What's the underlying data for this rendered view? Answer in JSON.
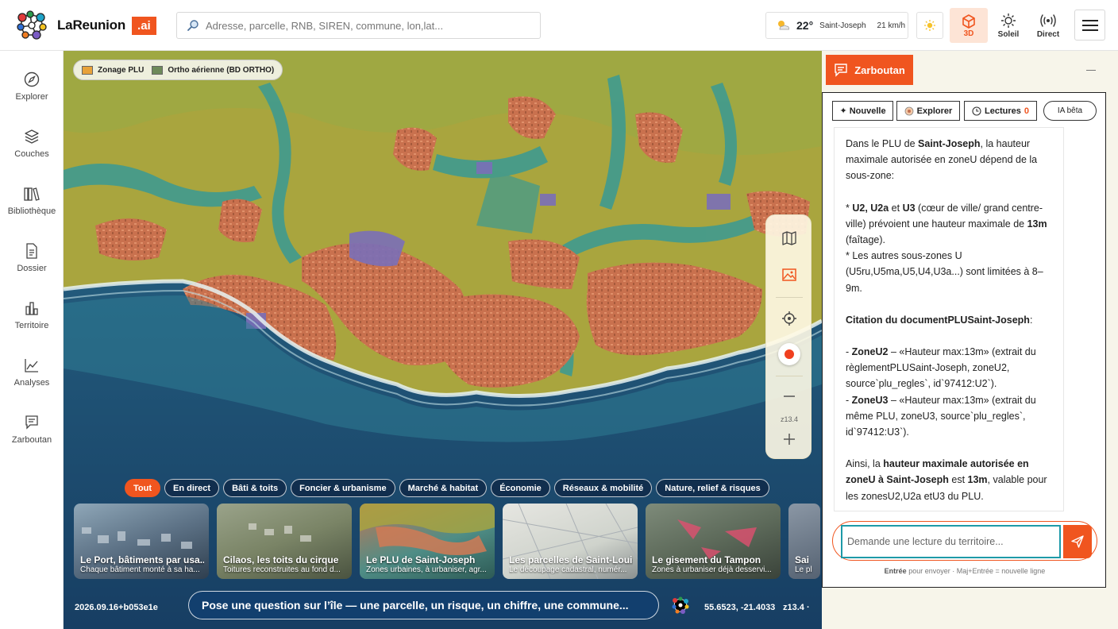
{
  "header": {
    "brand": "LaReunion",
    "brand_badge": ".ai",
    "search_placeholder": "Adresse, parcelle, RNB, SIREN, commune, lon,lat...",
    "weather": {
      "temp": "22°",
      "city": "Saint-Joseph",
      "wind": "21 km/h",
      "icon": "partly-cloudy-icon"
    },
    "tools": [
      {
        "label": "3D",
        "icon": "cube-icon",
        "active": true
      },
      {
        "label": "Soleil",
        "icon": "sun-icon"
      },
      {
        "label": "Direct",
        "icon": "broadcast-icon"
      }
    ],
    "accent": "#f0551f"
  },
  "nav": [
    {
      "label": "Explorer",
      "icon": "compass-icon"
    },
    {
      "label": "Couches",
      "icon": "layers-icon"
    },
    {
      "label": "Bibliothèque",
      "icon": "books-icon"
    },
    {
      "label": "Dossier",
      "icon": "document-icon"
    },
    {
      "label": "Territoire",
      "icon": "bar-chart-icon"
    },
    {
      "label": "Analyses",
      "icon": "line-chart-icon"
    },
    {
      "label": "Zarboutan",
      "icon": "chat-icon"
    }
  ],
  "map": {
    "layers": [
      {
        "label": "Zonage PLU",
        "color": "#e8a23a"
      },
      {
        "label": "Ortho aérienne (BD ORTHO)",
        "color": "#6e8a5a"
      }
    ],
    "zoom_label": "z13.4",
    "chips": [
      "Tout",
      "En direct",
      "Bâti & toits",
      "Foncier & urbanisme",
      "Marché & habitat",
      "Économie",
      "Réseaux & mobilité",
      "Nature, relief & risques"
    ],
    "active_chip": "Tout",
    "cards": [
      {
        "title": "Le Port, bâtiments par usa...",
        "subtitle": "Chaque bâtiment monté à sa ha..."
      },
      {
        "title": "Cilaos, les toits du cirque",
        "subtitle": "Toitures reconstruites au fond d..."
      },
      {
        "title": "Le PLU de Saint-Joseph",
        "subtitle": "Zones urbaines, à urbaniser, agr..."
      },
      {
        "title": "Les parcelles de Saint-Louis",
        "subtitle": "Le découpage cadastral, numér..."
      },
      {
        "title": "Le gisement du Tampon",
        "subtitle": "Zones à urbaniser déjà desservi..."
      },
      {
        "title": "Sai",
        "subtitle": "Le pl"
      }
    ],
    "version": "2026.09.16+b053e1e",
    "ask_placeholder": "Pose une question sur l’île — une parcelle, un risque, un chiffre, une commune...",
    "coords": "55.6523, -21.4033",
    "zoom_value": "z13.4",
    "trailing_dot": "·"
  },
  "panel": {
    "tab_label": "Zarboutan",
    "buttons": {
      "new": "✦ Nouvelle",
      "explore": "Explorer",
      "readings": "Lectures",
      "readings_count": "0",
      "ai": "IA bêta"
    },
    "message": {
      "p1_a": "Dans le PLU de ",
      "p1_b": "Saint-Joseph",
      "p1_c": ", la hauteur maximale autorisée en zoneU dépend de la sous-zone:",
      "b1_a": "* ",
      "b1_b": "U2, U2a",
      "b1_c": " et ",
      "b1_d": "U3",
      "b1_e": " (cœur de ville/ grand centre-ville) prévoient une hauteur maximale de ",
      "b1_f": "13m",
      "b1_g": " (faîtage).",
      "b2": "* Les autres sous-zones U (U5ru,U5ma,U5,U4,U3a...) sont limitées à 8–9m.",
      "cite_head": "Citation du documentPLUSaint-Joseph",
      "cite_colon": ":",
      "c1_a": "- ",
      "c1_b": "ZoneU2",
      "c1_c": " – «Hauteur max:13m» (extrait du règlementPLUSaint-Joseph, zoneU2, source`plu_regles`, id`97412:U2`).",
      "c2_a": "- ",
      "c2_b": "ZoneU3",
      "c2_c": " – «Hauteur max:13m» (extrait du même PLU, zoneU3, source`plu_regles`, id`97412:U3`).",
      "end_a": "Ainsi, la ",
      "end_b": "hauteur maximale autorisée en zoneU à Saint-Joseph",
      "end_c": " est ",
      "end_d": "13m",
      "end_e": ", valable pour les zonesU2,U2a etU3 du PLU."
    },
    "input_placeholder": "Demande une lecture du territoire...",
    "hint_key1": "Entrée",
    "hint_text1": " pour envoyer · ",
    "hint_key2": "Maj+Entrée",
    "hint_text2": " = nouvelle ligne"
  }
}
